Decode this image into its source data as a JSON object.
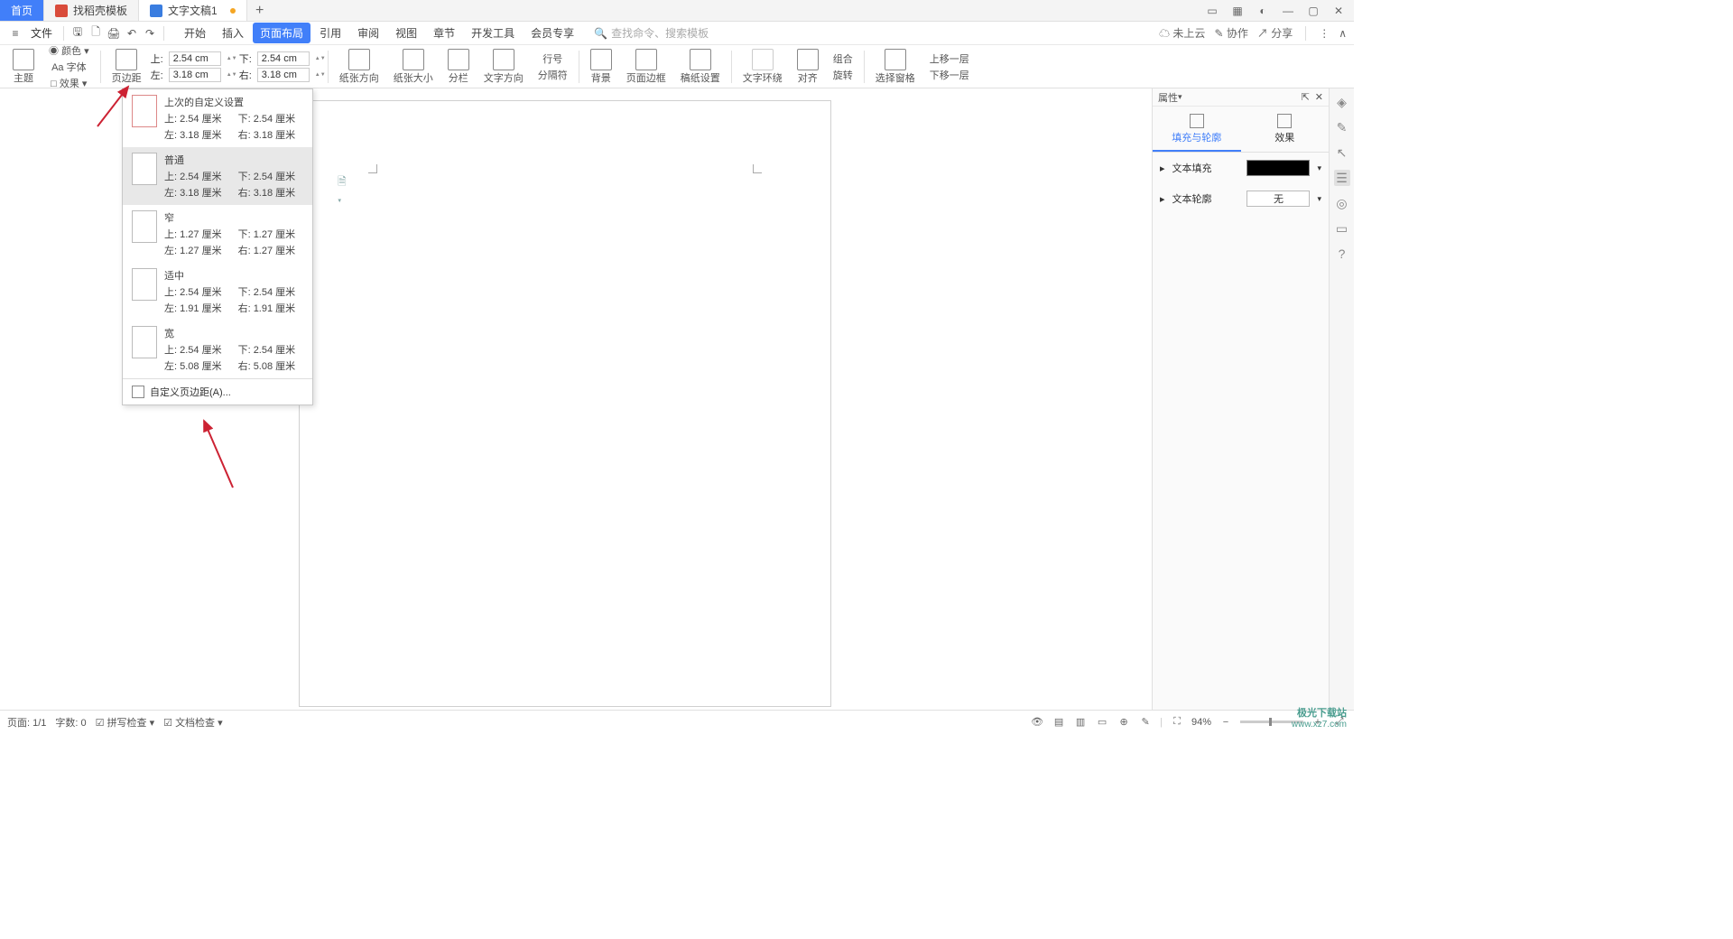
{
  "tabs": {
    "home": "首页",
    "docer": "找稻壳模板",
    "doc": "文字文稿1"
  },
  "menu": {
    "file": "文件",
    "items": [
      "开始",
      "插入",
      "页面布局",
      "引用",
      "审阅",
      "视图",
      "章节",
      "开发工具",
      "会员专享"
    ],
    "active_index": 2,
    "search_ph": "查找命令、搜索模板",
    "right": {
      "cloud": "未上云",
      "collab": "协作",
      "share": "分享"
    }
  },
  "ribbon": {
    "theme": "主题",
    "color": "颜色",
    "font": "Aa 字体",
    "effect": "效果",
    "margins": "页边距",
    "m": {
      "top_lbl": "上:",
      "top": "2.54 cm",
      "bot_lbl": "下:",
      "bot": "2.54 cm",
      "left_lbl": "左:",
      "left": "3.18 cm",
      "right_lbl": "右:",
      "right": "3.18 cm"
    },
    "orient": "纸张方向",
    "size": "纸张大小",
    "columns": "分栏",
    "textdir": "文字方向",
    "lineno": "行号",
    "breaks": "分隔符",
    "bg": "背景",
    "border": "页面边框",
    "grid": "稿纸设置",
    "wrap": "文字环绕",
    "align": "对齐",
    "rotate": "旋转",
    "selpane": "选择窗格",
    "group": "组合",
    "fwd": "上移一层",
    "back": "下移一层"
  },
  "dropdown": {
    "items": [
      {
        "title": "上次的自定义设置",
        "t": "上: 2.54 厘米",
        "b": "下: 2.54 厘米",
        "l": "左: 3.18 厘米",
        "r": "右: 3.18 厘米"
      },
      {
        "title": "普通",
        "t": "上: 2.54 厘米",
        "b": "下: 2.54 厘米",
        "l": "左: 3.18 厘米",
        "r": "右: 3.18 厘米"
      },
      {
        "title": "窄",
        "t": "上: 1.27 厘米",
        "b": "下: 1.27 厘米",
        "l": "左: 1.27 厘米",
        "r": "右: 1.27 厘米"
      },
      {
        "title": "适中",
        "t": "上: 2.54 厘米",
        "b": "下: 2.54 厘米",
        "l": "左: 1.91 厘米",
        "r": "右: 1.91 厘米"
      },
      {
        "title": "宽",
        "t": "上: 2.54 厘米",
        "b": "下: 2.54 厘米",
        "l": "左: 5.08 厘米",
        "r": "右: 5.08 厘米"
      }
    ],
    "custom": "自定义页边距(A)..."
  },
  "rpanel": {
    "title": "属性",
    "tab_fill": "填充与轮廓",
    "tab_fx": "效果",
    "text_fill": "文本填充",
    "text_outline": "文本轮廓",
    "none": "无"
  },
  "status": {
    "page": "页面: 1/1",
    "words": "字数: 0",
    "spell": "拼写检查",
    "doccheck": "文档检查",
    "zoom": "94%"
  },
  "watermark": {
    "l1": "极光下载站",
    "l2": "www.xz7.com"
  }
}
